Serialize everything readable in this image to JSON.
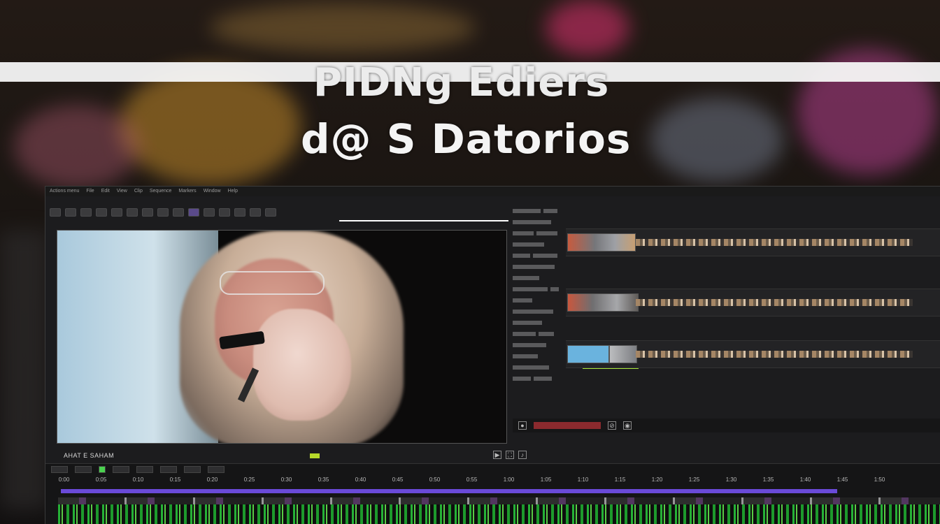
{
  "headline": {
    "line1": "PIDNg Ediers",
    "line2": "d@ S Datorios"
  },
  "editor": {
    "viewer_label": "AHAT E SAHAM",
    "menu": [
      "Actions menu",
      "File",
      "Edit",
      "View",
      "Clip",
      "Sequence",
      "Markers",
      "Window",
      "Help"
    ],
    "timeline_ruler": [
      "0:00",
      "0:05",
      "0:10",
      "0:15",
      "0:20",
      "0:25",
      "0:30",
      "0:35",
      "0:40",
      "0:45",
      "0:50",
      "0:55",
      "1:00",
      "1:05",
      "1:10",
      "1:15",
      "1:20",
      "1:25",
      "1:30",
      "1:35",
      "1:40",
      "1:45",
      "1:50"
    ]
  },
  "colors": {
    "audio_waveform": "#27c23a",
    "video_track": "#6a4ad8",
    "meter": "#8b2a2e",
    "accent_chip": "#a8e83a"
  }
}
